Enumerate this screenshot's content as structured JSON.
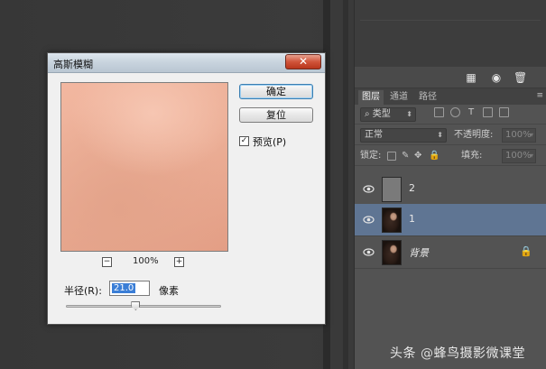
{
  "dialog": {
    "title": "高斯模糊",
    "close_glyph": "✕",
    "ok_label": "确定",
    "reset_label": "复位",
    "preview_label": "预览(P)",
    "preview_checked": true,
    "zoom_out_glyph": "−",
    "zoom_in_glyph": "+",
    "zoom": "100%",
    "radius_label": "半径(R):",
    "radius_value": "21.0",
    "radius_unit": "像素",
    "radius_slider_fraction": 0.45
  },
  "layers_panel": {
    "tabs": [
      "图层",
      "通道",
      "路径"
    ],
    "active_tab": 0,
    "menu_glyph": "≡",
    "filter_kind": "类型",
    "blend_mode": "正常",
    "opacity_label": "不透明度:",
    "opacity_value": "100%",
    "lock_label": "锁定:",
    "fill_label": "填充:",
    "fill_value": "100%",
    "toolbar_icons": [
      "new-group-icon",
      "camera-icon",
      "trash-icon"
    ],
    "layers": [
      {
        "name": "2",
        "visible": true,
        "selected": false,
        "thumb": "gray",
        "locked": false
      },
      {
        "name": "1",
        "visible": true,
        "selected": true,
        "thumb": "photo",
        "locked": false
      },
      {
        "name": "背景",
        "visible": true,
        "selected": false,
        "thumb": "photo",
        "locked": true
      }
    ]
  },
  "watermark": {
    "prefix": "头条",
    "at": "@",
    "account": "蜂鸟摄影微课堂"
  },
  "colors": {
    "workspace": "#3a3a3a",
    "panel": "#535353",
    "selected_layer": "#5f7593",
    "preview_skin": "#ecaf97",
    "close_button": "#d0543a"
  }
}
